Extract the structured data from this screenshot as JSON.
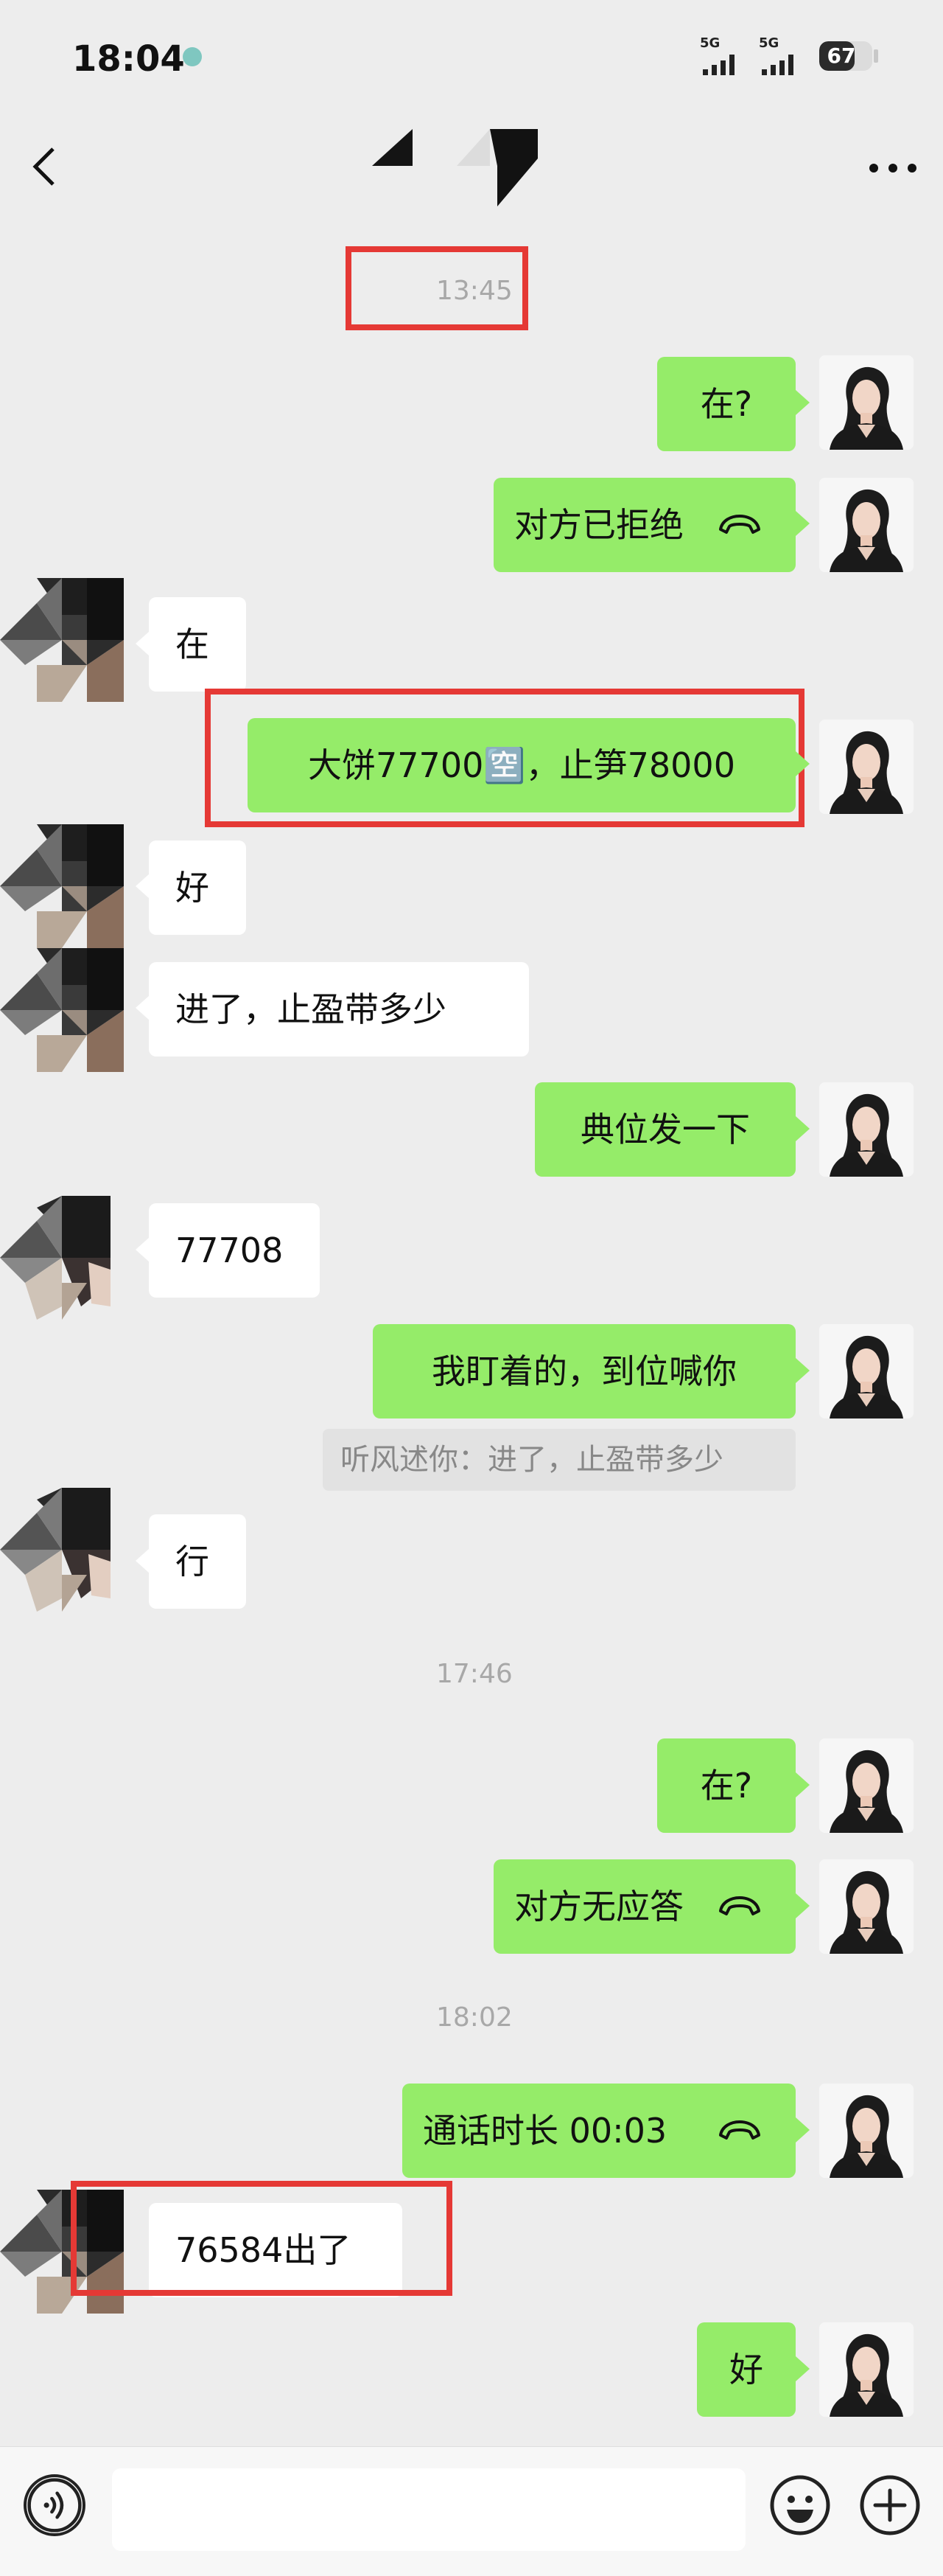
{
  "status_bar": {
    "time": "18:04",
    "network1": "5G",
    "network2": "5G",
    "battery": "67",
    "battery_level": 0.67
  },
  "nav": {
    "back_icon": "chevron-left-icon",
    "more_icon": "ellipsis-icon"
  },
  "chat": {
    "timestamps": [
      "13:45",
      "17:46",
      "18:02"
    ],
    "messages": [
      {
        "from": "me",
        "text": "在?"
      },
      {
        "from": "me",
        "text": "对方已拒绝",
        "icon": "hangup-icon"
      },
      {
        "from": "them",
        "text": "在"
      },
      {
        "from": "me",
        "text": "大饼77700🈳，止笋78000"
      },
      {
        "from": "them",
        "text": "好"
      },
      {
        "from": "them",
        "text": "进了，止盈带多少"
      },
      {
        "from": "me",
        "text": "典位发一下"
      },
      {
        "from": "them",
        "text": "77708"
      },
      {
        "from": "me",
        "text": "我盯着的，到位喊你"
      },
      {
        "from": "them",
        "text": "行"
      },
      {
        "from": "me",
        "text": "在?"
      },
      {
        "from": "me",
        "text": "对方无应答",
        "icon": "hangup-icon"
      },
      {
        "from": "me",
        "text": "通话时长 00:03",
        "icon": "hangup-icon"
      },
      {
        "from": "them",
        "text": "76584出了"
      },
      {
        "from": "me",
        "text": "好"
      }
    ],
    "quote": "听风述你：进了，止盈带多少"
  },
  "input_bar": {
    "voice_icon": "voice-icon",
    "emoji_icon": "emoji-icon",
    "plus_icon": "plus-icon",
    "placeholder": ""
  },
  "colors": {
    "my_bubble": "#95ec69",
    "their_bubble": "#ffffff",
    "background": "#ededed",
    "highlight": "#e53935"
  }
}
